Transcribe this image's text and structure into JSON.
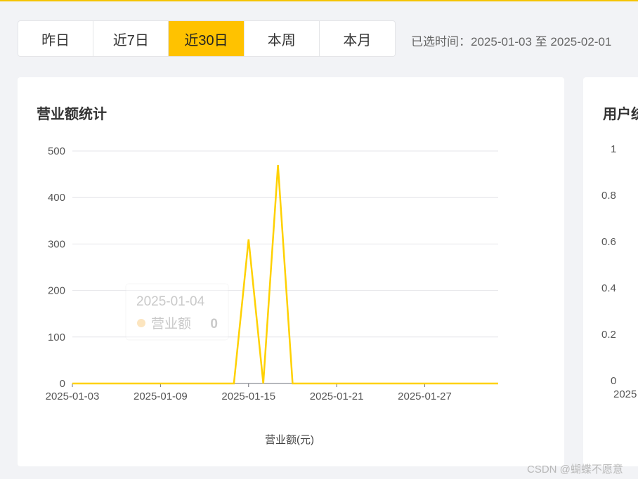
{
  "filters": {
    "tabs": [
      {
        "label": "昨日",
        "active": false
      },
      {
        "label": "近7日",
        "active": false
      },
      {
        "label": "近30日",
        "active": true
      },
      {
        "label": "本周",
        "active": false
      },
      {
        "label": "本月",
        "active": false
      }
    ],
    "selected_range_label": "已选时间：2025-01-03 至 2025-02-01"
  },
  "revenue_card": {
    "title": "营业额统计"
  },
  "user_card": {
    "title_partial": "用户统",
    "y_ticks": [
      "1",
      "0.8",
      "0.6",
      "0.4",
      "0.2",
      "0"
    ],
    "x_tick_partial": "2025"
  },
  "chart_data": {
    "type": "line",
    "title": "营业额统计",
    "xlabel": "营业额(元)",
    "ylabel": "",
    "ylim": [
      0,
      500
    ],
    "y_ticks": [
      0,
      100,
      200,
      300,
      400,
      500
    ],
    "x_ticks": [
      "2025-01-03",
      "2025-01-09",
      "2025-01-15",
      "2025-01-21",
      "2025-01-27"
    ],
    "x": [
      "2025-01-03",
      "2025-01-04",
      "2025-01-05",
      "2025-01-06",
      "2025-01-07",
      "2025-01-08",
      "2025-01-09",
      "2025-01-10",
      "2025-01-11",
      "2025-01-12",
      "2025-01-13",
      "2025-01-14",
      "2025-01-15",
      "2025-01-16",
      "2025-01-17",
      "2025-01-18",
      "2025-01-19",
      "2025-01-20",
      "2025-01-21",
      "2025-01-22",
      "2025-01-23",
      "2025-01-24",
      "2025-01-25",
      "2025-01-26",
      "2025-01-27",
      "2025-01-28",
      "2025-01-29",
      "2025-01-30",
      "2025-01-31",
      "2025-02-01"
    ],
    "series": [
      {
        "name": "营业额",
        "color": "#ffd100",
        "values": [
          0,
          0,
          0,
          0,
          0,
          0,
          0,
          0,
          0,
          0,
          0,
          0,
          310,
          0,
          470,
          0,
          0,
          0,
          0,
          0,
          0,
          0,
          0,
          0,
          0,
          0,
          0,
          0,
          0,
          0
        ]
      }
    ],
    "grid": true,
    "tooltip": {
      "date": "2025-01-04",
      "series_name": "营业额",
      "value": "0"
    }
  },
  "watermark": "CSDN @蝴蝶不愿意"
}
